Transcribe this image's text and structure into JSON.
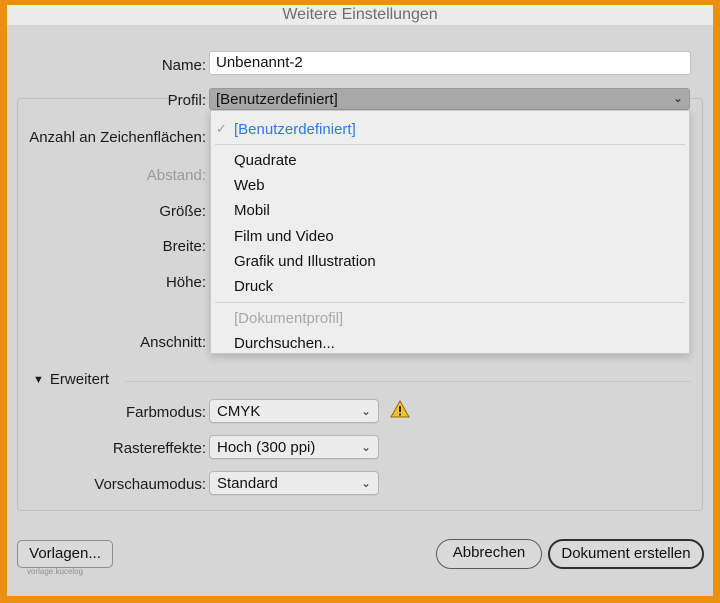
{
  "window": {
    "title": "Weitere Einstellungen"
  },
  "fields": {
    "name_label": "Name:",
    "name_value": "Unbenannt-2",
    "profil_label": "Profil:",
    "profil_value": "[Benutzerdefiniert]",
    "artboards_label": "Anzahl an Zeichenflächen:",
    "abstand_label": "Abstand:",
    "groesse_label": "Größe:",
    "breite_label": "Breite:",
    "hoehe_label": "Höhe:",
    "anschnitt_label": "Anschnitt:"
  },
  "profil_menu": {
    "items": [
      {
        "label": "[Benutzerdefiniert]",
        "state": "selected"
      },
      {
        "label": "Quadrate",
        "state": "normal"
      },
      {
        "label": "Web",
        "state": "normal"
      },
      {
        "label": "Mobil",
        "state": "normal"
      },
      {
        "label": "Film und Video",
        "state": "normal"
      },
      {
        "label": "Grafik und Illustration",
        "state": "normal"
      },
      {
        "label": "Druck",
        "state": "normal"
      },
      {
        "label": "[Dokumentprofil]",
        "state": "disabled"
      },
      {
        "label": "Durchsuchen...",
        "state": "normal"
      }
    ],
    "check_glyph": "✓"
  },
  "advanced": {
    "toggle_label": "Erweitert",
    "farbmodus_label": "Farbmodus:",
    "farbmodus_value": "CMYK",
    "raster_label": "Rastereffekte:",
    "raster_value": "Hoch (300 ppi)",
    "vorschau_label": "Vorschaumodus:",
    "vorschau_value": "Standard"
  },
  "buttons": {
    "vorlagen": "Vorlagen...",
    "abbrechen": "Abbrechen",
    "erstellen": "Dokument erstellen"
  },
  "watermark": "vorlage.kucelog",
  "colors": {
    "accent": "#2B7BE0",
    "frame": "#E8900F",
    "warning": "#F2C230"
  }
}
